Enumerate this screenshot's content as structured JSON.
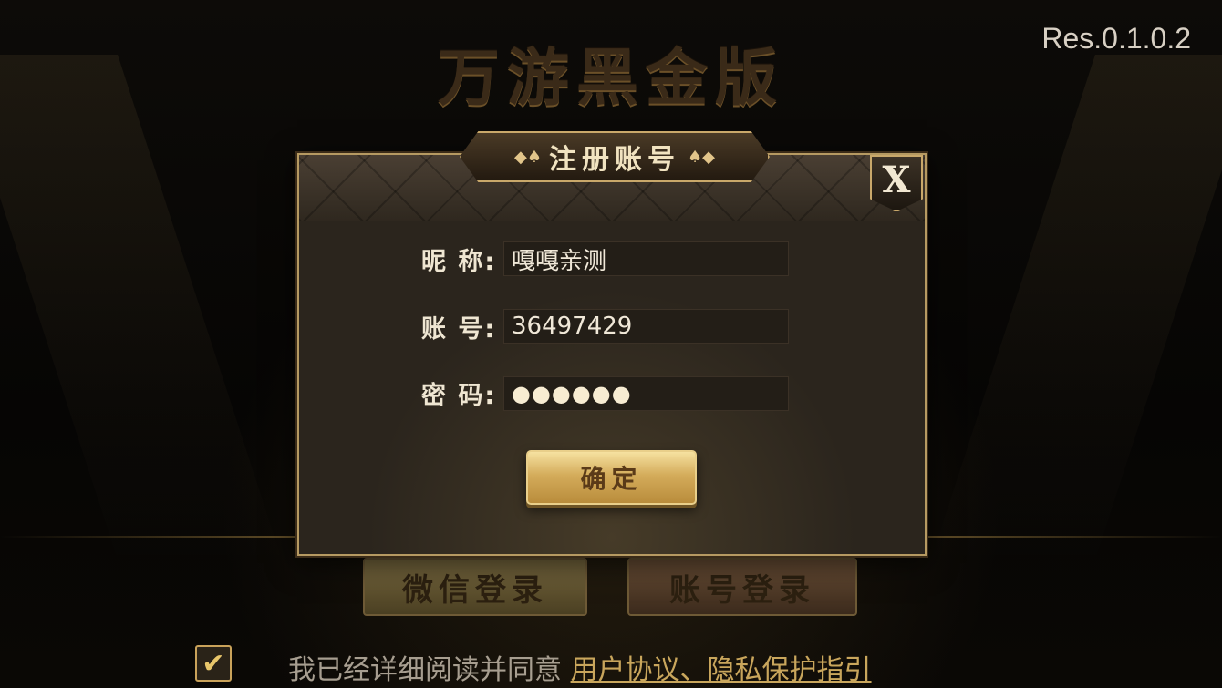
{
  "app": {
    "game_title": "万游黑金版",
    "version": "Res.0.1.0.2"
  },
  "register_dialog": {
    "title": "注册账号",
    "close_label": "X",
    "fields": {
      "nickname_label": "昵 称:",
      "nickname_value": "嘎嘎亲测",
      "account_label": "账 号:",
      "account_value": "36497429",
      "password_label": "密 码:",
      "password_value": "●●●●●●"
    },
    "confirm_label": "确定"
  },
  "login_buttons": {
    "wechat_label": "微信登录",
    "account_label": "账号登录"
  },
  "agreement": {
    "checked": true,
    "check_glyph": "✔",
    "text": "我已经详细阅读并同意",
    "link_text": "用户协议、隐私保护指引"
  },
  "colors": {
    "gold_accent": "#c9a86a",
    "button_gold": "#d4ac5b",
    "dialog_bg": "#2a241c"
  }
}
